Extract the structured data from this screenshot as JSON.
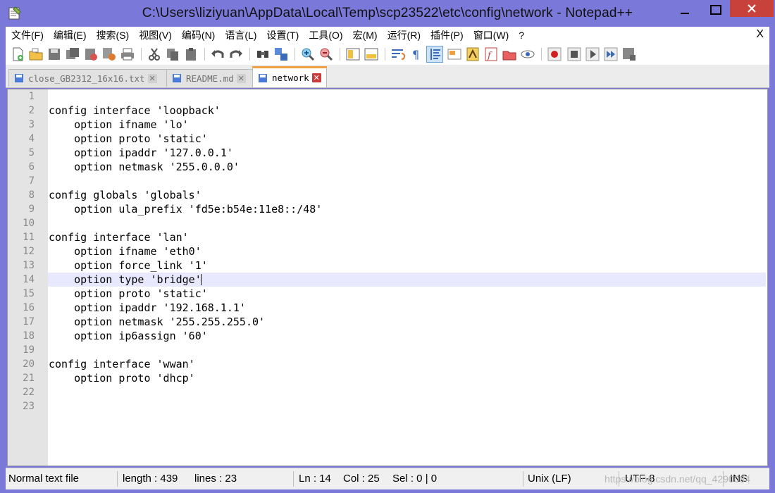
{
  "window": {
    "title": "C:\\Users\\liziyuan\\AppData\\Local\\Temp\\scp23522\\etc\\config\\network - Notepad++"
  },
  "menu": {
    "items": [
      "文件(F)",
      "编辑(E)",
      "搜索(S)",
      "视图(V)",
      "编码(N)",
      "语言(L)",
      "设置(T)",
      "工具(O)",
      "宏(M)",
      "运行(R)",
      "插件(P)",
      "窗口(W)",
      "?"
    ],
    "close": "X"
  },
  "tabs": [
    {
      "label": "close_GB2312_16x16.txt",
      "active": false
    },
    {
      "label": "README.md",
      "active": false
    },
    {
      "label": "network",
      "active": true
    }
  ],
  "editor": {
    "current_line": 14,
    "lines": [
      "",
      "config interface 'loopback'",
      "    option ifname 'lo'",
      "    option proto 'static'",
      "    option ipaddr '127.0.0.1'",
      "    option netmask '255.0.0.0'",
      "",
      "config globals 'globals'",
      "    option ula_prefix 'fd5e:b54e:11e8::/48'",
      "",
      "config interface 'lan'",
      "    option ifname 'eth0'",
      "    option force_link '1'",
      "    option type 'bridge'",
      "    option proto 'static'",
      "    option ipaddr '192.168.1.1'",
      "    option netmask '255.255.255.0'",
      "    option ip6assign '60'",
      "",
      "config interface 'wwan'",
      "    option proto 'dhcp'",
      "",
      ""
    ]
  },
  "status": {
    "file_type": "Normal text file",
    "length": "length : 439",
    "lines": "lines : 23",
    "ln": "Ln : 14",
    "col": "Col : 25",
    "sel": "Sel : 0 | 0",
    "eol": "Unix (LF)",
    "encoding": "UTF-8",
    "mode": "INS",
    "watermark": "https://blog.csdn.net/qq_4290084"
  },
  "colors": {
    "frame": "#7a78d8",
    "close_button": "#c8413a",
    "current_line": "#e8e8ff",
    "active_tab_accent": "#f0a040"
  }
}
